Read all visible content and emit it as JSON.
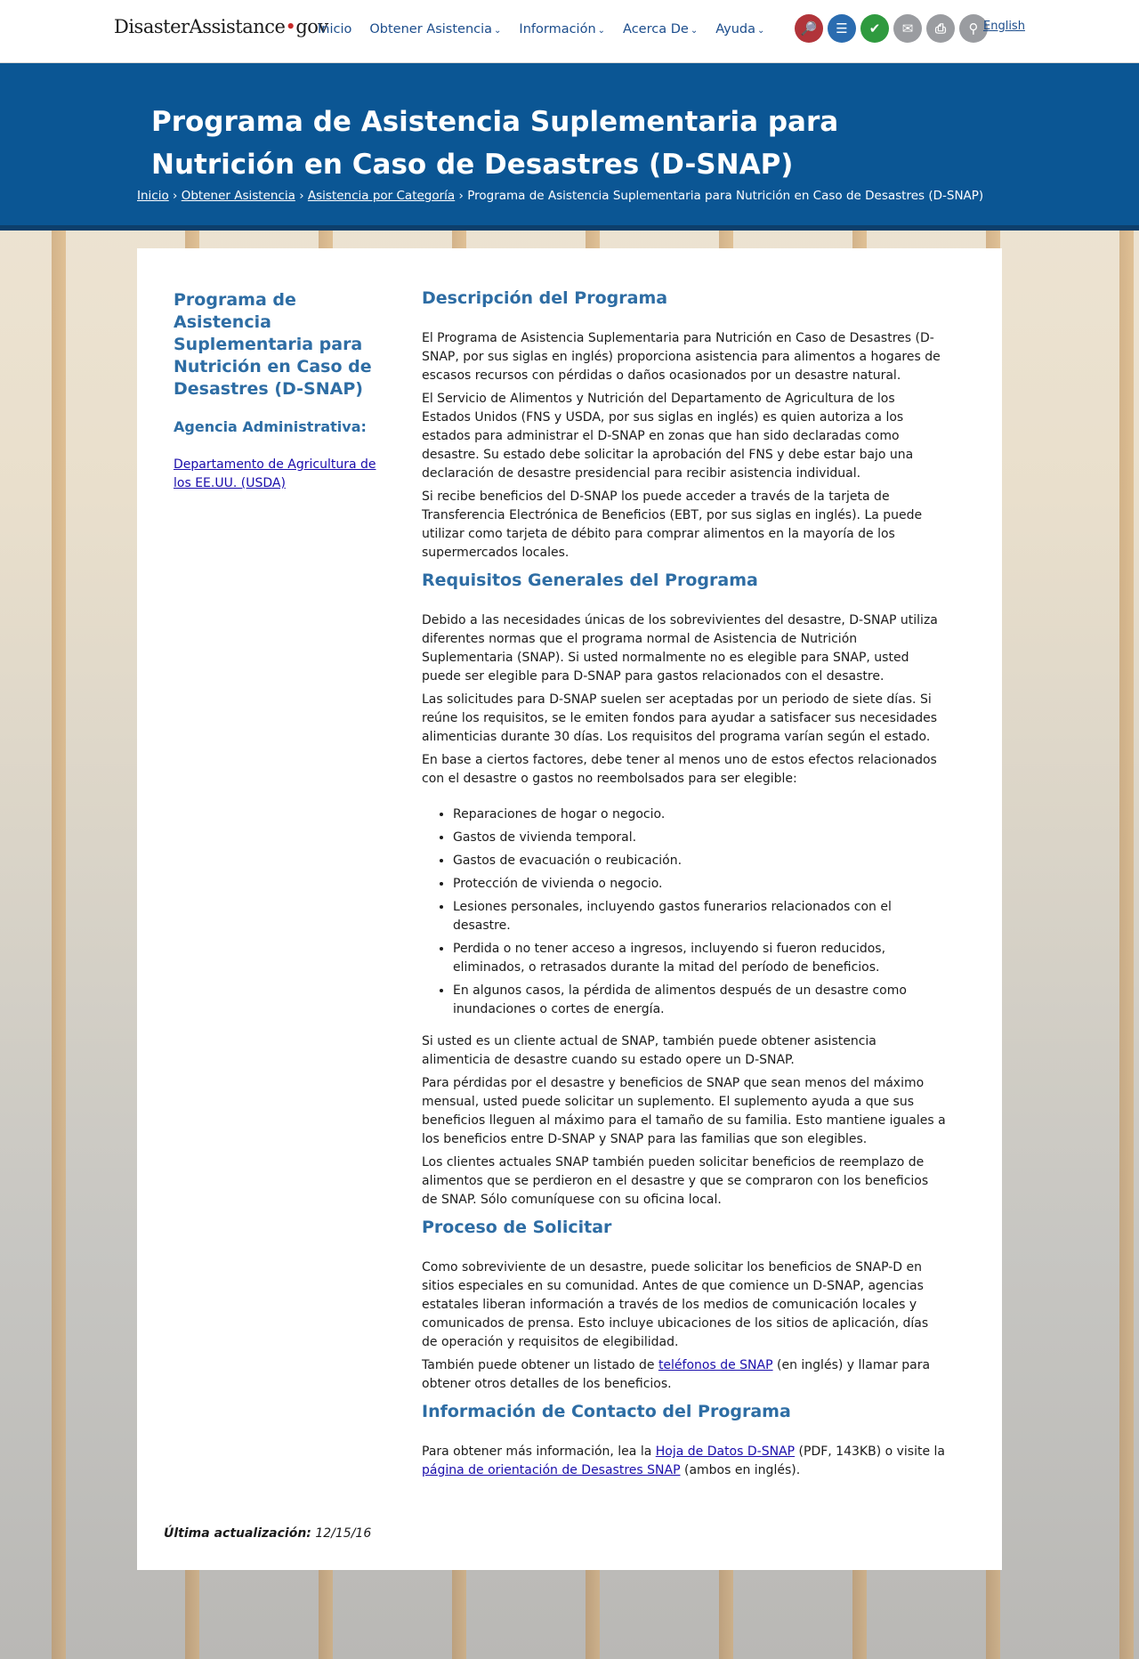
{
  "header": {
    "logo_part1": "Disaster",
    "logo_part2": "Assistance",
    "logo_dot": "•",
    "logo_part3": "gov",
    "nav": [
      {
        "label": "Inicio",
        "chevron": ""
      },
      {
        "label": "Obtener Asistencia",
        "chevron": "⌄"
      },
      {
        "label": "Información",
        "chevron": "⌄"
      },
      {
        "label": "Acerca De",
        "chevron": "⌄"
      },
      {
        "label": "Ayuda",
        "chevron": "⌄"
      }
    ],
    "tools": [
      {
        "icon": "apply-search-icon",
        "glyph": "🔎"
      },
      {
        "icon": "checklist-icon",
        "glyph": "☰"
      },
      {
        "icon": "check-status-icon",
        "glyph": "✔"
      },
      {
        "icon": "email-icon",
        "glyph": "✉"
      },
      {
        "icon": "print-icon",
        "glyph": "⎙"
      },
      {
        "icon": "search-icon",
        "glyph": "⚲"
      }
    ],
    "language_link": "English",
    "colors": {
      "brand_blue": "#0b5694",
      "link_blue": "#1c4d8c",
      "accent_red": "#b1343a",
      "accent_green": "#2f9a3f"
    }
  },
  "hero": {
    "title": "Programa de Asistencia Suplementaria para Nutrición en Caso de Desastres (D-SNAP)",
    "breadcrumb": [
      {
        "label": "Inicio"
      },
      {
        "label": "Obtener Asistencia"
      },
      {
        "label": "Asistencia por Categoría"
      }
    ],
    "breadcrumb_sep": "›",
    "breadcrumb_current": "Programa de Asistencia Suplementaria para Nutrición en Caso de Desastres (D-SNAP)"
  },
  "sidebar": {
    "title": "Programa de Asistencia Suplementaria para Nutrición en Caso de Desastres (D-SNAP)",
    "agency_heading": "Agencia Administrativa:",
    "agency_link": "Departamento de Agricultura de los EE.UU. (USDA)"
  },
  "main": {
    "desc_heading": "Descripción del Programa",
    "desc_p1": "El Programa de Asistencia Suplementaria para Nutrición en Caso de Desastres (D-SNAP, por sus siglas en inglés) proporciona asistencia para alimentos a hogares de escasos recursos con pérdidas o daños ocasionados por un desastre natural.",
    "desc_p2": "El Servicio de Alimentos y Nutrición del Departamento de Agricultura de los Estados Unidos (FNS y USDA, por sus siglas en inglés) es quien autoriza a los estados para administrar el D-SNAP en zonas que han sido declaradas como desastre. Su estado debe solicitar la aprobación del FNS y debe estar bajo una declaración de desastre presidencial para recibir asistencia individual.",
    "desc_p3": "Si recibe beneficios del D-SNAP los puede acceder a través de la tarjeta de Transferencia Electrónica de Beneficios (EBT, por sus siglas en inglés). La puede utilizar como tarjeta de débito para comprar alimentos en la mayoría de los supermercados locales.",
    "req_heading": "Requisitos Generales del Programa",
    "req_p1": "Debido a las necesidades únicas de los sobrevivientes del desastre, D-SNAP utiliza diferentes normas que el programa normal de Asistencia de Nutrición Suplementaria (SNAP). Si usted normalmente no es elegible para SNAP, usted puede ser elegible para D-SNAP para gastos relacionados con el desastre.",
    "req_p2": "Las solicitudes para D-SNAP suelen ser aceptadas por un periodo de siete días. Si reúne los requisitos, se le emiten fondos para ayudar a satisfacer sus necesidades alimenticias durante 30 días. Los requisitos del programa varían según el estado.",
    "req_p3": "En base a ciertos factores, debe tener al menos uno de estos efectos relacionados con el desastre o gastos no reembolsados para ser elegible:",
    "req_list": [
      "Reparaciones de hogar o negocio.",
      "Gastos de vivienda temporal.",
      "Gastos de evacuación o reubicación.",
      "Protección de vivienda o negocio.",
      "Lesiones personales, incluyendo gastos funerarios relacionados con el desastre.",
      "Perdida o no tener acceso a ingresos, incluyendo si fueron reducidos, eliminados, o retrasados durante la mitad del período de beneficios.",
      "En algunos casos, la pérdida de alimentos después de un desastre como inundaciones o cortes de energía."
    ],
    "req_p4": "Si usted es un cliente actual de SNAP, también puede obtener asistencia alimenticia de desastre cuando su estado opere un D-SNAP.",
    "req_p5": "Para pérdidas por el desastre y beneficios de SNAP que sean menos del máximo mensual, usted puede solicitar un suplemento. El suplemento ayuda a que sus beneficios lleguen al máximo para el tamaño de su familia. Esto mantiene iguales a los beneficios entre D-SNAP y SNAP para las familias que son elegibles.",
    "req_p6": "Los clientes actuales SNAP también pueden solicitar beneficios de reemplazo de alimentos que se perdieron en el desastre y que se compraron con los beneficios de SNAP. Sólo comuníquese con su oficina local.",
    "proc_heading": "Proceso de Solicitar",
    "proc_p1": "Como sobreviviente de un desastre, puede solicitar los beneficios de SNAP-D en sitios especiales en su comunidad. Antes de que comience un D-SNAP, agencias estatales liberan información a través de los medios de comunicación locales y comunicados de prensa. Esto incluye ubicaciones de los sitios de aplicación, días de operación y requisitos de elegibilidad.",
    "proc_p2_pre": "También puede obtener un listado de ",
    "proc_p2_link": "teléfonos de SNAP",
    "proc_p2_post": " (en inglés) y llamar para obtener otros detalles de los beneficios.",
    "contact_heading": "Información de Contacto del Programa",
    "contact_pre": "Para obtener más información, lea la ",
    "contact_link1": "Hoja de Datos D-SNAP",
    "contact_mid": " (PDF, 143KB) o visite la ",
    "contact_link2": "página de orientación de Desastres SNAP",
    "contact_post": " (ambos en inglés)."
  },
  "footer": {
    "updated_label": "Última actualización:",
    "updated_date": "12/15/16"
  }
}
